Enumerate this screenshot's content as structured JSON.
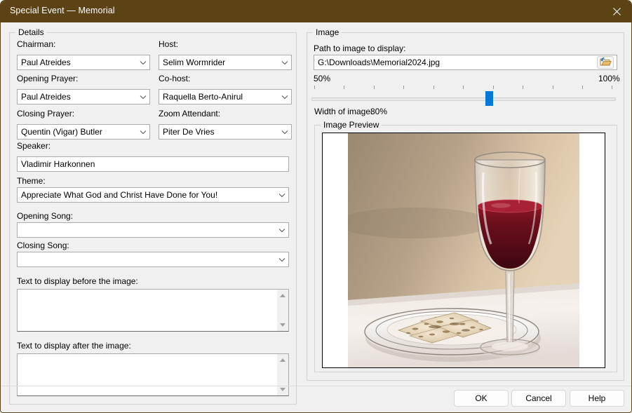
{
  "window": {
    "title": "Special Event — Memorial",
    "titlebar_color": "#5C4214",
    "background_color": "#F0F0F0",
    "close_icon": "close-icon"
  },
  "details": {
    "group_label": "Details",
    "fields": [
      {
        "label": "Chairman:",
        "value": "Paul Atreides",
        "type": "combo"
      },
      {
        "label": "Host:",
        "value": "Selim Wormrider",
        "type": "combo"
      },
      {
        "label": "Opening Prayer:",
        "value": "Paul Atreides",
        "type": "combo"
      },
      {
        "label": "Co-host:",
        "value": "Raquella Berto-Anirul",
        "type": "combo"
      },
      {
        "label": "Closing Prayer:",
        "value": "Quentin (Vigar) Butler",
        "type": "combo"
      },
      {
        "label": "Zoom Attendant:",
        "value": "Piter De Vries",
        "type": "combo"
      },
      {
        "label": "Speaker:",
        "value": "Vladimir Harkonnen",
        "type": "text"
      },
      {
        "label": "Theme:",
        "value": "Appreciate What God and Christ Have Done for You!",
        "type": "combo"
      },
      {
        "label": "Opening Song:",
        "value": "",
        "type": "combo"
      },
      {
        "label": "Closing Song:",
        "value": "",
        "type": "combo"
      }
    ],
    "text_before": {
      "label": "Text to display before the image:",
      "value": ""
    },
    "text_after": {
      "label": "Text to display after the image:",
      "value": ""
    }
  },
  "image": {
    "group_label": "Image",
    "path_label": "Path to image to display:",
    "path_value": "G:\\Downloads\\Memorial2024.jpg",
    "browse_icon": "open-folder-icon",
    "slider": {
      "min_label": "50%",
      "max_label": "100%",
      "min": 50,
      "max": 100,
      "value": 80,
      "tick_count": 11,
      "thumb_color": "#0078D7"
    },
    "width_label": "Width of image:",
    "width_value": "80%",
    "preview_group_label": "Image Preview",
    "preview_alt": "Wine glass with red wine beside a plate of unleavened bread on a white tablecloth"
  },
  "buttons": {
    "ok": "OK",
    "cancel": "Cancel",
    "help": "Help"
  }
}
